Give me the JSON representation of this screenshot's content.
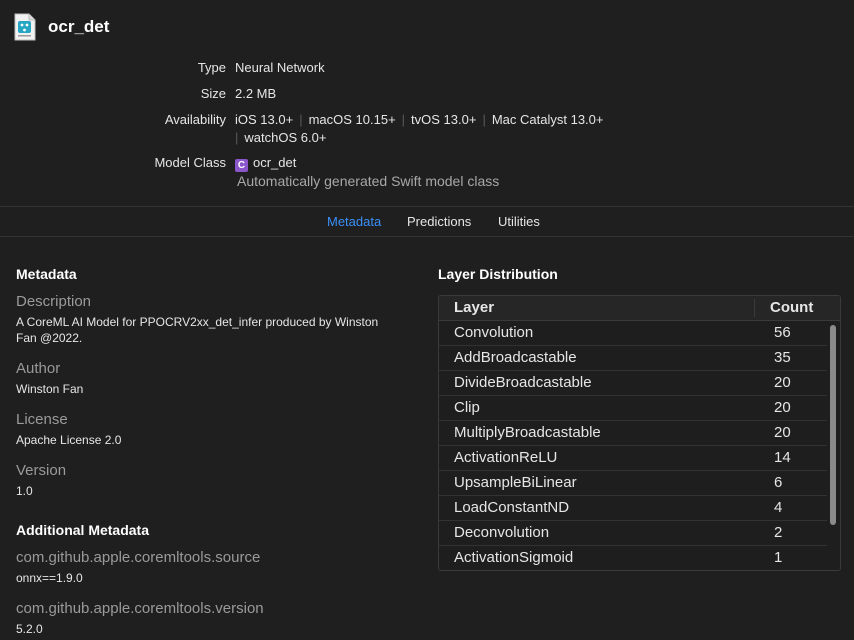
{
  "header": {
    "title": "ocr_det",
    "file_icon": "mlmodel-file-icon",
    "type_label": "Type",
    "type_value": "Neural Network",
    "size_label": "Size",
    "size_value": "2.2 MB",
    "availability_label": "Availability",
    "availability": [
      "iOS 13.0+",
      "macOS 10.15+",
      "tvOS 13.0+",
      "Mac Catalyst 13.0+",
      "watchOS 6.0+"
    ],
    "model_class_label": "Model Class",
    "class_badge": "C",
    "model_class_value": "ocr_det",
    "model_class_sub": "Automatically generated Swift model class"
  },
  "tabs": [
    {
      "label": "Metadata",
      "active": true
    },
    {
      "label": "Predictions",
      "active": false
    },
    {
      "label": "Utilities",
      "active": false
    }
  ],
  "metadata": {
    "title": "Metadata",
    "description_label": "Description",
    "description_value": "A CoreML AI Model for PPOCRV2xx_det_infer produced by Winston Fan @2022.",
    "author_label": "Author",
    "author_value": "Winston Fan",
    "license_label": "License",
    "license_value": "Apache License 2.0",
    "version_label": "Version",
    "version_value": "1.0"
  },
  "additional_metadata": {
    "title": "Additional Metadata",
    "items": [
      {
        "key": "com.github.apple.coremltools.source",
        "value": "onnx==1.9.0"
      },
      {
        "key": "com.github.apple.coremltools.version",
        "value": "5.2.0"
      }
    ]
  },
  "layer_distribution": {
    "title": "Layer Distribution",
    "columns": [
      "Layer",
      "Count"
    ],
    "rows": [
      {
        "layer": "Convolution",
        "count": "56"
      },
      {
        "layer": "AddBroadcastable",
        "count": "35"
      },
      {
        "layer": "DivideBroadcastable",
        "count": "20"
      },
      {
        "layer": "Clip",
        "count": "20"
      },
      {
        "layer": "MultiplyBroadcastable",
        "count": "20"
      },
      {
        "layer": "ActivationReLU",
        "count": "14"
      },
      {
        "layer": "UpsampleBiLinear",
        "count": "6"
      },
      {
        "layer": "LoadConstantND",
        "count": "4"
      },
      {
        "layer": "Deconvolution",
        "count": "2"
      },
      {
        "layer": "ActivationSigmoid",
        "count": "1"
      }
    ]
  },
  "colors": {
    "background": "#1f1f1f",
    "accent": "#3b8ff7",
    "class_badge": "#8a56c9"
  }
}
